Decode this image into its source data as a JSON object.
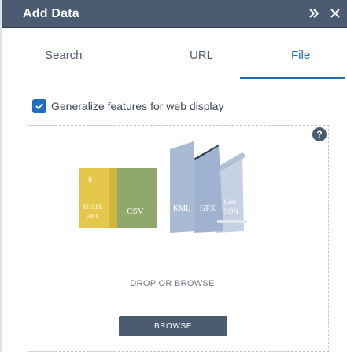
{
  "panel": {
    "title": "Add Data",
    "collapse_icon": "double-chevron-right-icon",
    "close_icon": "close-icon"
  },
  "tabs": [
    {
      "label": "Search",
      "selected": false
    },
    {
      "label": "URL",
      "selected": false
    },
    {
      "label": "File",
      "selected": true
    }
  ],
  "options": {
    "generalize_label": "Generalize features for web display",
    "generalize_checked": true
  },
  "dropzone": {
    "help_icon": "help-icon",
    "file_types": [
      "SHAPE FILE",
      "CSV",
      "KML",
      "GPX",
      "Geo JSON"
    ],
    "drop_text": "DROP OR BROWSE",
    "browse_label": "BROWSE"
  },
  "colors": {
    "header": "#4b5c72",
    "accent": "#1b6ec2",
    "shapefile": "#e6c74d",
    "csv": "#8fa86c",
    "kml_gpx": "#9fb2cf",
    "geojson": "#c6d2e3"
  }
}
